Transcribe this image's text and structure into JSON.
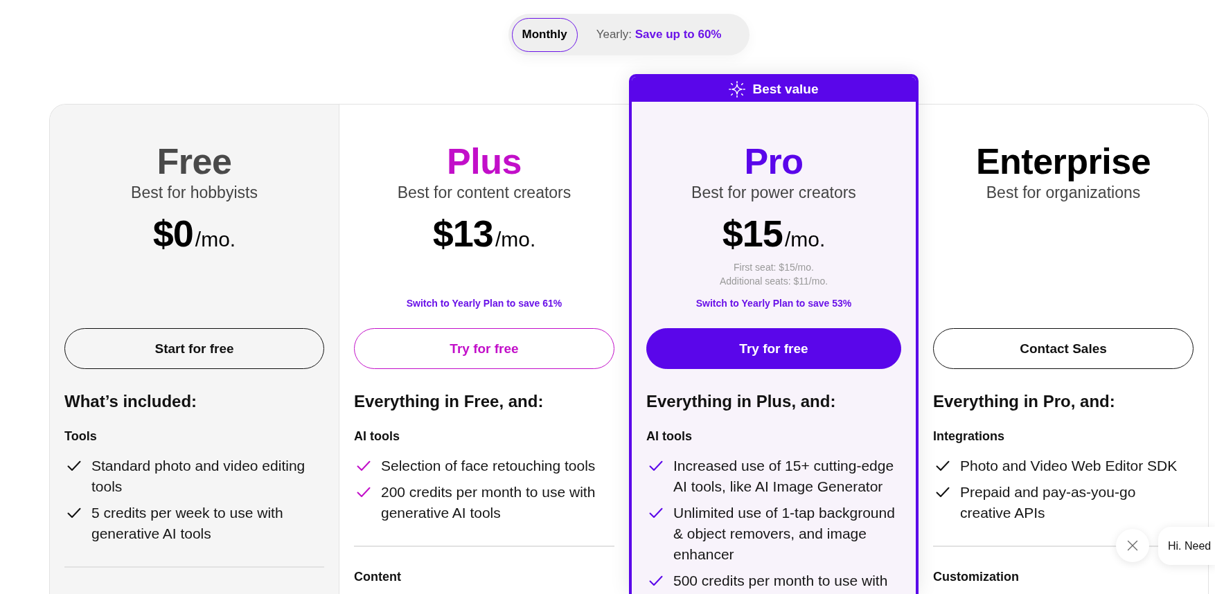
{
  "billing_toggle": {
    "options": [
      {
        "label": "Monthly",
        "selected": true
      },
      {
        "label": "Yearly:",
        "note": "Save up to 60%",
        "selected": false
      }
    ]
  },
  "plans": [
    {
      "kind": "basic",
      "name": "Free",
      "color": "#4a4a4a",
      "tagline": "Best for hobbyists",
      "price": "$0",
      "period": "/mo.",
      "button": {
        "label": "Start for free",
        "kind": "outline",
        "color": "#111111"
      },
      "features_heading": "What’s included:",
      "checkmark": {
        "color": "#111111"
      },
      "sections": [
        {
          "title": "Tools",
          "items": [
            "Standard photo and video editing tools",
            "5 credits per week to use with generative AI tools"
          ]
        }
      ]
    },
    {
      "kind": "standard",
      "name": "Plus",
      "color": "#c20fc9",
      "tagline": "Best for content creators",
      "price": "$13",
      "period": "/mo.",
      "savings_note": "Switch to Yearly Plan to save 61%",
      "button": {
        "label": "Try for free",
        "kind": "outline",
        "color": "#c20fc9"
      },
      "features_heading": "Everything in Free, and:",
      "checkmark": {
        "color": "#c20fc9"
      },
      "sections": [
        {
          "title": "AI tools",
          "items": [
            "Selection of face retouching tools",
            "200 credits per month to use with generative AI tools"
          ]
        },
        {
          "title": "Content"
        }
      ]
    },
    {
      "kind": "featured",
      "badge": {
        "label": "Best value"
      },
      "name": "Pro",
      "color": "#5a06ea",
      "tagline": "Best for power creators",
      "price": "$15",
      "period": "/mo.",
      "seat_notes": [
        "First seat: $15/mo.",
        "Additional seats: $11/mo."
      ],
      "savings_note": "Switch to Yearly Plan to save 53%",
      "button": {
        "label": "Try for free",
        "kind": "filled",
        "color": "#5a06ea"
      },
      "features_heading": "Everything in Plus, and:",
      "checkmark": {
        "color": "#5a06ea"
      },
      "sections": [
        {
          "title": "AI tools",
          "items": [
            "Increased use of 15+ cutting-edge AI tools, like AI Image Generator",
            "Unlimited use of 1-tap background & object removers, and image enhancer",
            "500 credits per month to use with"
          ]
        }
      ]
    },
    {
      "kind": "standard",
      "name": "Enterprise",
      "color": "#000000",
      "tagline": "Best for organizations",
      "button": {
        "label": "Contact Sales",
        "kind": "outline",
        "color": "#111111"
      },
      "features_heading": "Everything in Pro, and:",
      "checkmark": {
        "color": "#111111"
      },
      "sections": [
        {
          "title": "Integrations",
          "items": [
            "Photo and Video Web Editor SDK",
            "Prepaid and pay-as-you-go creative APIs"
          ]
        },
        {
          "title": "Customization"
        }
      ]
    }
  ],
  "chat_widget": {
    "message": "Hi. Need"
  }
}
